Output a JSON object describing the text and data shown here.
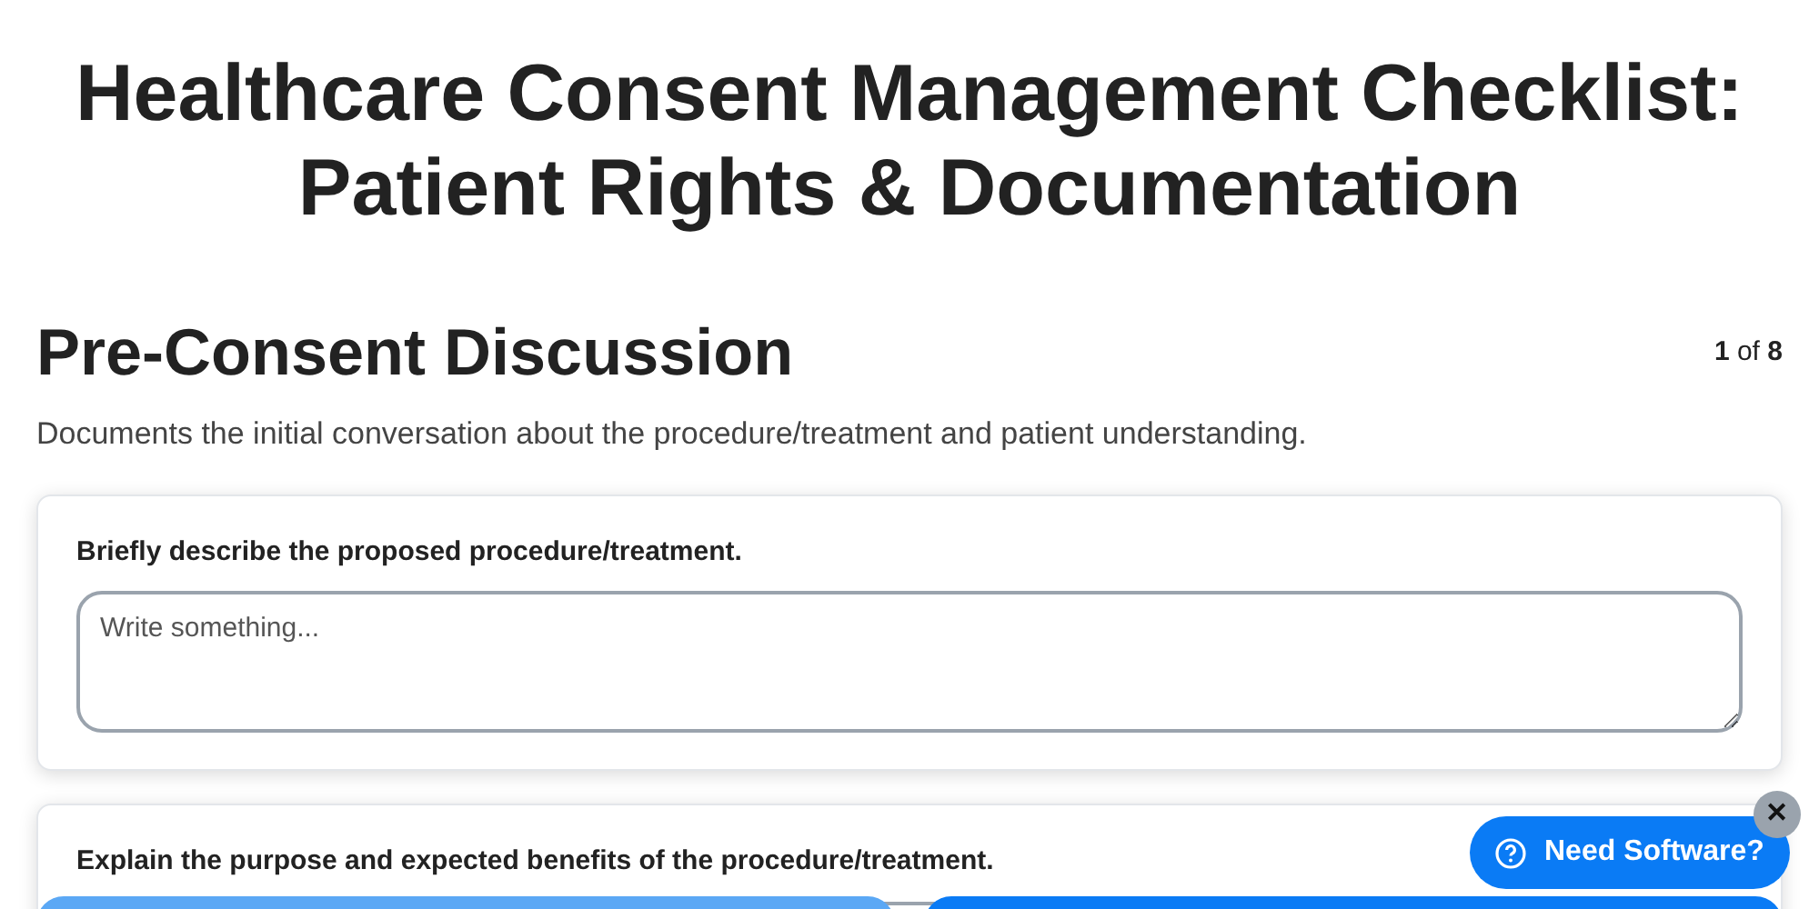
{
  "title": "Healthcare Consent Management Checklist: Patient Rights & Documentation",
  "section": {
    "heading": "Pre-Consent Discussion",
    "counter": "**1** of **8**",
    "description": "Documents the initial conversation about the procedure/treatment and patient understanding."
  },
  "questions": [
    {
      "label": "Briefly describe the proposed procedure/treatment.",
      "placeholder": "Write something..."
    },
    {
      "label": "Explain the purpose and expected benefits of the procedure/treatment."
    }
  ],
  "help_widget": {
    "label": "Need Software?",
    "close": "✕"
  }
}
